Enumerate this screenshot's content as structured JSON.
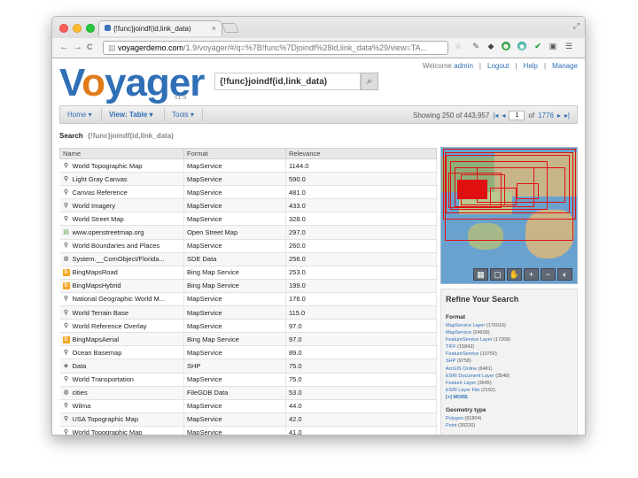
{
  "browser": {
    "tab_title": "{!func}joindf(id,link_data)",
    "tab_close": "×",
    "url_host": "voyagerdemo.com",
    "url_rest": "/1.9/voyager/#/q=%7B!func%7Djoindf%28id,link_data%29/view=TA...",
    "back": "←",
    "forward": "→",
    "reload": "C"
  },
  "header": {
    "logo_prefix": "V",
    "logo_o": "o",
    "logo_suffix": "yager",
    "version": "v1.9",
    "search_value": "{!func}joindf(id,link_data)",
    "user_links": [
      {
        "label": "Welcome",
        "link": "admin"
      },
      {
        "label": "Logout"
      },
      {
        "label": "Help"
      },
      {
        "label": "Manage"
      }
    ]
  },
  "toolbar": {
    "home": "Home",
    "view": "View: Table",
    "tools": "Tools",
    "showing": "Showing 250 of 443,957",
    "page": "1",
    "of": "of",
    "total_pages": "1776"
  },
  "search_line": {
    "label": "Search",
    "query": "{!func}joindf(id,link_data)"
  },
  "table": {
    "headers": [
      "Name",
      "Format",
      "Relevance"
    ],
    "rows": [
      {
        "name": "World Topographic Map",
        "format": "MapService",
        "relevance": "1144.0",
        "icon": "globe"
      },
      {
        "name": "Light Gray Canvas",
        "format": "MapService",
        "relevance": "590.0",
        "icon": "globe"
      },
      {
        "name": "Canvas Reference",
        "format": "MapService",
        "relevance": "481.0",
        "icon": "globe"
      },
      {
        "name": "World Imagery",
        "format": "MapService",
        "relevance": "433.0",
        "icon": "globe"
      },
      {
        "name": "World Street Map",
        "format": "MapService",
        "relevance": "328.0",
        "icon": "globe"
      },
      {
        "name": "www.openstreetmap.org",
        "format": "Open Street Map",
        "relevance": "297.0",
        "icon": "osm"
      },
      {
        "name": "World Boundaries and Places",
        "format": "MapService",
        "relevance": "260.0",
        "icon": "globe"
      },
      {
        "name": "System.__ComObject/Florida...",
        "format": "SDE Data",
        "relevance": "256.0",
        "icon": "db"
      },
      {
        "name": "BingMapsRoad",
        "format": "Bing Map Service",
        "relevance": "253.0",
        "icon": "bing"
      },
      {
        "name": "BingMapsHybrid",
        "format": "Bing Map Service",
        "relevance": "199.0",
        "icon": "bing"
      },
      {
        "name": "National Geographic World M...",
        "format": "MapService",
        "relevance": "176.0",
        "icon": "globe"
      },
      {
        "name": "World Terrain Base",
        "format": "MapService",
        "relevance": "115.0",
        "icon": "globe"
      },
      {
        "name": "World Reference Overlay",
        "format": "MapService",
        "relevance": "97.0",
        "icon": "globe"
      },
      {
        "name": "BingMapsAerial",
        "format": "Bing Map Service",
        "relevance": "97.0",
        "icon": "bing"
      },
      {
        "name": "Ocean Basemap",
        "format": "MapService",
        "relevance": "89.0",
        "icon": "globe"
      },
      {
        "name": "Data",
        "format": "SHP",
        "relevance": "75.0",
        "icon": "shp"
      },
      {
        "name": "World Transportation",
        "format": "MapService",
        "relevance": "75.0",
        "icon": "globe"
      },
      {
        "name": "cities",
        "format": "FileGDB Data",
        "relevance": "53.0",
        "icon": "db"
      },
      {
        "name": "Wilma",
        "format": "MapService",
        "relevance": "44.0",
        "icon": "globe"
      },
      {
        "name": "USA Topographic Map",
        "format": "MapService",
        "relevance": "42.0",
        "icon": "globe"
      },
      {
        "name": "World Topographic Map",
        "format": "MapService",
        "relevance": "41.0",
        "icon": "globe"
      }
    ]
  },
  "map": {
    "tools": [
      "▦",
      "▢",
      "✋",
      "+",
      "−",
      "◐"
    ]
  },
  "refine": {
    "title": "Refine Your Search",
    "format_heading": "Format",
    "formats": [
      {
        "label": "MapService Layer",
        "count": "(176010)"
      },
      {
        "label": "MapService",
        "count": "(24609)"
      },
      {
        "label": "FeatureService Layer",
        "count": "(17268)"
      },
      {
        "label": "TIFF",
        "count": "(15842)"
      },
      {
        "label": "FeatureService",
        "count": "(10750)"
      },
      {
        "label": "SHP",
        "count": "(9758)"
      },
      {
        "label": "ArcGIS Online",
        "count": "(6481)"
      },
      {
        "label": "ESRI Document Layer",
        "count": "(3548)"
      },
      {
        "label": "Feature Layer",
        "count": "(3645)"
      },
      {
        "label": "ESRI Layer File",
        "count": "(2152)"
      }
    ],
    "more": "[+] MORE",
    "geometry_heading": "Geometry type",
    "geometry": [
      {
        "label": "Polygon",
        "count": "(91804)"
      },
      {
        "label": "Point",
        "count": "(30220)"
      }
    ]
  },
  "colors": {
    "brand_blue": "#2f6fb6",
    "logo_orange": "#e07b1a",
    "footprint_red": "#e01010"
  }
}
